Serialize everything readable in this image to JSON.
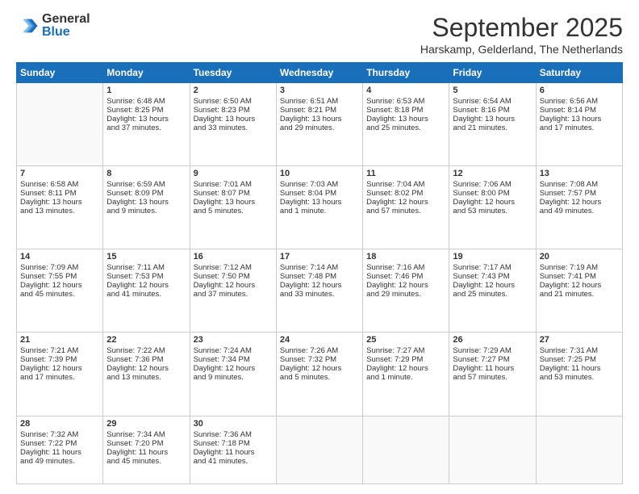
{
  "logo": {
    "general": "General",
    "blue": "Blue"
  },
  "header": {
    "month": "September 2025",
    "location": "Harskamp, Gelderland, The Netherlands"
  },
  "weekdays": [
    "Sunday",
    "Monday",
    "Tuesday",
    "Wednesday",
    "Thursday",
    "Friday",
    "Saturday"
  ],
  "rows": [
    [
      {
        "day": "",
        "info": ""
      },
      {
        "day": "1",
        "info": "Sunrise: 6:48 AM\nSunset: 8:25 PM\nDaylight: 13 hours\nand 37 minutes."
      },
      {
        "day": "2",
        "info": "Sunrise: 6:50 AM\nSunset: 8:23 PM\nDaylight: 13 hours\nand 33 minutes."
      },
      {
        "day": "3",
        "info": "Sunrise: 6:51 AM\nSunset: 8:21 PM\nDaylight: 13 hours\nand 29 minutes."
      },
      {
        "day": "4",
        "info": "Sunrise: 6:53 AM\nSunset: 8:18 PM\nDaylight: 13 hours\nand 25 minutes."
      },
      {
        "day": "5",
        "info": "Sunrise: 6:54 AM\nSunset: 8:16 PM\nDaylight: 13 hours\nand 21 minutes."
      },
      {
        "day": "6",
        "info": "Sunrise: 6:56 AM\nSunset: 8:14 PM\nDaylight: 13 hours\nand 17 minutes."
      }
    ],
    [
      {
        "day": "7",
        "info": "Sunrise: 6:58 AM\nSunset: 8:11 PM\nDaylight: 13 hours\nand 13 minutes."
      },
      {
        "day": "8",
        "info": "Sunrise: 6:59 AM\nSunset: 8:09 PM\nDaylight: 13 hours\nand 9 minutes."
      },
      {
        "day": "9",
        "info": "Sunrise: 7:01 AM\nSunset: 8:07 PM\nDaylight: 13 hours\nand 5 minutes."
      },
      {
        "day": "10",
        "info": "Sunrise: 7:03 AM\nSunset: 8:04 PM\nDaylight: 13 hours\nand 1 minute."
      },
      {
        "day": "11",
        "info": "Sunrise: 7:04 AM\nSunset: 8:02 PM\nDaylight: 12 hours\nand 57 minutes."
      },
      {
        "day": "12",
        "info": "Sunrise: 7:06 AM\nSunset: 8:00 PM\nDaylight: 12 hours\nand 53 minutes."
      },
      {
        "day": "13",
        "info": "Sunrise: 7:08 AM\nSunset: 7:57 PM\nDaylight: 12 hours\nand 49 minutes."
      }
    ],
    [
      {
        "day": "14",
        "info": "Sunrise: 7:09 AM\nSunset: 7:55 PM\nDaylight: 12 hours\nand 45 minutes."
      },
      {
        "day": "15",
        "info": "Sunrise: 7:11 AM\nSunset: 7:53 PM\nDaylight: 12 hours\nand 41 minutes."
      },
      {
        "day": "16",
        "info": "Sunrise: 7:12 AM\nSunset: 7:50 PM\nDaylight: 12 hours\nand 37 minutes."
      },
      {
        "day": "17",
        "info": "Sunrise: 7:14 AM\nSunset: 7:48 PM\nDaylight: 12 hours\nand 33 minutes."
      },
      {
        "day": "18",
        "info": "Sunrise: 7:16 AM\nSunset: 7:46 PM\nDaylight: 12 hours\nand 29 minutes."
      },
      {
        "day": "19",
        "info": "Sunrise: 7:17 AM\nSunset: 7:43 PM\nDaylight: 12 hours\nand 25 minutes."
      },
      {
        "day": "20",
        "info": "Sunrise: 7:19 AM\nSunset: 7:41 PM\nDaylight: 12 hours\nand 21 minutes."
      }
    ],
    [
      {
        "day": "21",
        "info": "Sunrise: 7:21 AM\nSunset: 7:39 PM\nDaylight: 12 hours\nand 17 minutes."
      },
      {
        "day": "22",
        "info": "Sunrise: 7:22 AM\nSunset: 7:36 PM\nDaylight: 12 hours\nand 13 minutes."
      },
      {
        "day": "23",
        "info": "Sunrise: 7:24 AM\nSunset: 7:34 PM\nDaylight: 12 hours\nand 9 minutes."
      },
      {
        "day": "24",
        "info": "Sunrise: 7:26 AM\nSunset: 7:32 PM\nDaylight: 12 hours\nand 5 minutes."
      },
      {
        "day": "25",
        "info": "Sunrise: 7:27 AM\nSunset: 7:29 PM\nDaylight: 12 hours\nand 1 minute."
      },
      {
        "day": "26",
        "info": "Sunrise: 7:29 AM\nSunset: 7:27 PM\nDaylight: 11 hours\nand 57 minutes."
      },
      {
        "day": "27",
        "info": "Sunrise: 7:31 AM\nSunset: 7:25 PM\nDaylight: 11 hours\nand 53 minutes."
      }
    ],
    [
      {
        "day": "28",
        "info": "Sunrise: 7:32 AM\nSunset: 7:22 PM\nDaylight: 11 hours\nand 49 minutes."
      },
      {
        "day": "29",
        "info": "Sunrise: 7:34 AM\nSunset: 7:20 PM\nDaylight: 11 hours\nand 45 minutes."
      },
      {
        "day": "30",
        "info": "Sunrise: 7:36 AM\nSunset: 7:18 PM\nDaylight: 11 hours\nand 41 minutes."
      },
      {
        "day": "",
        "info": ""
      },
      {
        "day": "",
        "info": ""
      },
      {
        "day": "",
        "info": ""
      },
      {
        "day": "",
        "info": ""
      }
    ]
  ]
}
